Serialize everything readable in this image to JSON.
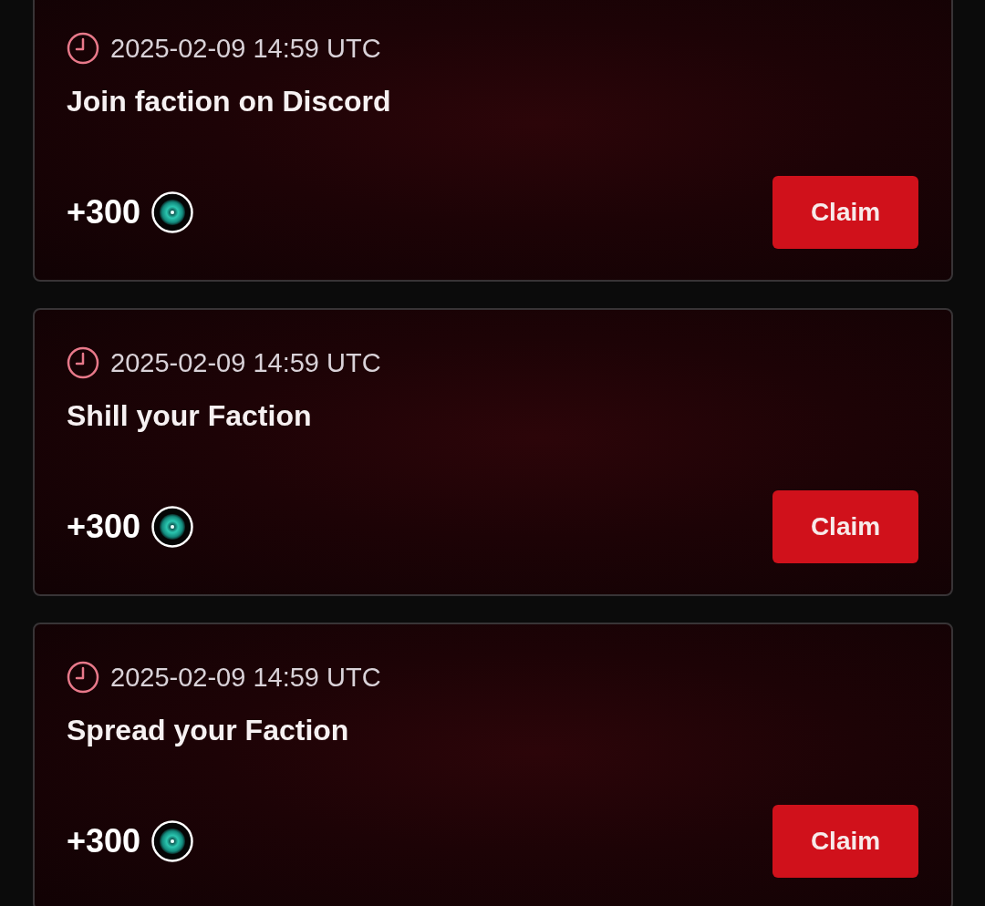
{
  "tasks": [
    {
      "time": "2025-02-09 14:59 UTC",
      "title": "Join faction on Discord",
      "reward": "+300",
      "button": "Claim"
    },
    {
      "time": "2025-02-09 14:59 UTC",
      "title": "Shill your Faction",
      "reward": "+300",
      "button": "Claim"
    },
    {
      "time": "2025-02-09 14:59 UTC",
      "title": "Spread your Faction",
      "reward": "+300",
      "button": "Claim"
    }
  ]
}
